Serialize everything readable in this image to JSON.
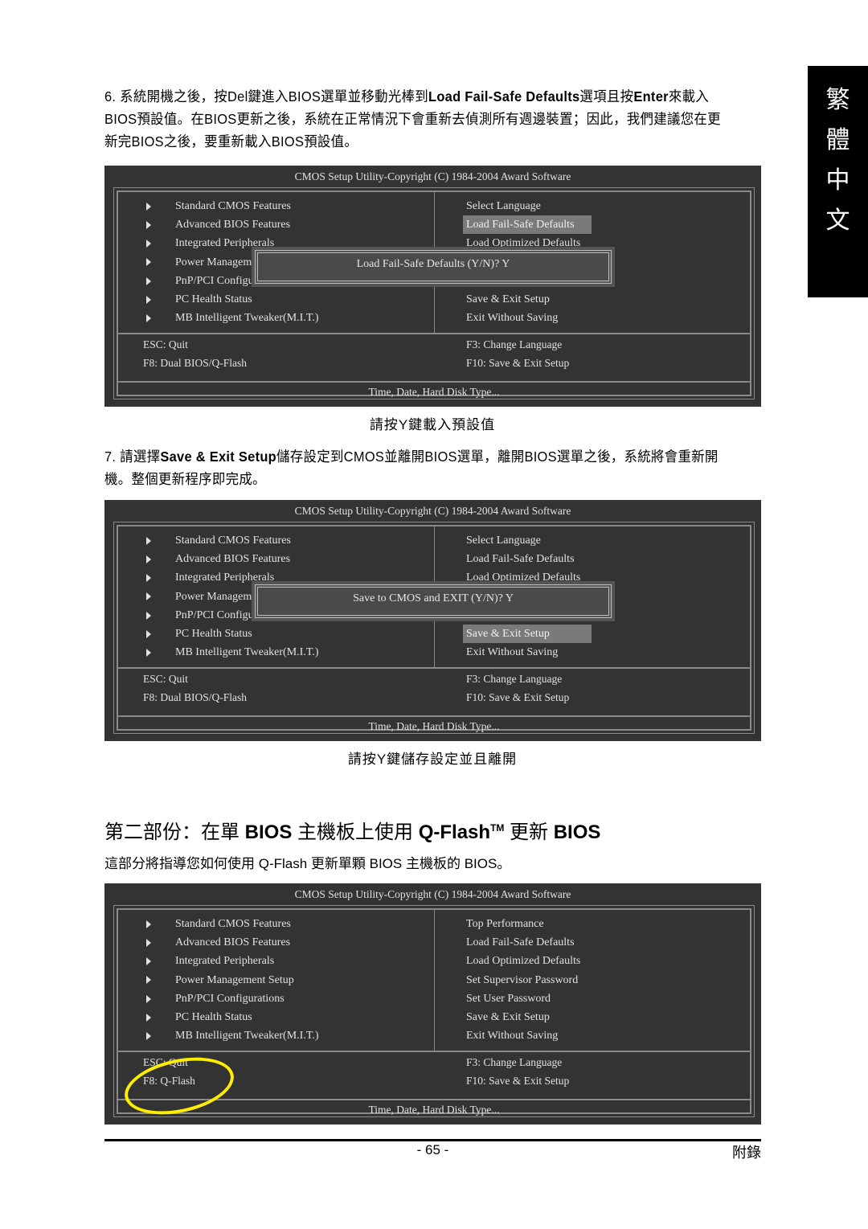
{
  "side_tab": {
    "chars": [
      "繁",
      "體",
      "中",
      "文"
    ]
  },
  "step6": {
    "num": "6.",
    "t1": " 系統開機之後，按Del鍵進入BIOS選單並移動光棒到",
    "b1": "Load Fail-Safe Defaults",
    "t2": "選項且按",
    "b2": "Enter",
    "t3": "來載入BIOS預設值。在BIOS更新之後，系統在正常情況下會重新去偵測所有週邊裝置；因此，我們建議您在更新完BIOS之後，要重新載入BIOS預設值。"
  },
  "caption1": "請按Y鍵載入預設值",
  "step7": {
    "num": "7.",
    "t1": " 請選擇",
    "b1": "Save & Exit Setup",
    "t2": "儲存設定到CMOS並離開BIOS選單，離開BIOS選單之後，系統將會重新開機。整個更新程序即完成。"
  },
  "caption2": "請按Y鍵儲存設定並且離開",
  "section": {
    "title_a": "第二部份：在單 ",
    "title_b": "BIOS",
    "title_c": " 主機板上使用 ",
    "title_d": "Q-Flash",
    "title_tm": "TM",
    "title_e": " 更新 ",
    "title_f": "BIOS",
    "subtitle": "這部分將指導您如何使用 Q-Flash 更新單顆 BIOS 主機板的 BIOS。"
  },
  "bios1": {
    "title": "CMOS Setup Utility-Copyright (C) 1984-2004 Award Software",
    "left": [
      "Standard CMOS Features",
      "Advanced BIOS Features",
      "Integrated Peripherals",
      "Power Management Setup",
      "PnP/PCI Configurations",
      "PC Health Status",
      "MB Intelligent Tweaker(M.I.T.)"
    ],
    "right": [
      "Select Language",
      "Load Fail-Safe Defaults",
      "Load Optimized Defaults",
      "",
      "",
      "Save & Exit Setup",
      "Exit Without Saving"
    ],
    "highlight_index": 1,
    "keys": {
      "esc": "ESC: Quit",
      "f8": "F8: Dual BIOS/Q-Flash",
      "f3": "F3: Change Language",
      "f10": "F10: Save & Exit Setup"
    },
    "footer": "Time, Date, Hard Disk Type...",
    "dialog": "Load Fail-Safe Defaults (Y/N)? Y"
  },
  "bios2": {
    "title": "CMOS Setup Utility-Copyright (C) 1984-2004 Award Software",
    "left": [
      "Standard CMOS Features",
      "Advanced BIOS Features",
      "Integrated Peripherals",
      "Power Management Setup",
      "PnP/PCI Configurations",
      "PC Health Status",
      "MB Intelligent Tweaker(M.I.T.)"
    ],
    "right": [
      "Select Language",
      "Load Fail-Safe Defaults",
      "Load Optimized Defaults",
      "",
      "",
      "Save & Exit Setup",
      "Exit Without Saving"
    ],
    "highlight_index": 5,
    "keys": {
      "esc": "ESC: Quit",
      "f8": "F8: Dual BIOS/Q-Flash",
      "f3": "F3: Change Language",
      "f10": "F10: Save & Exit Setup"
    },
    "footer": "Time, Date, Hard Disk Type...",
    "dialog": "Save to CMOS and EXIT (Y/N)? Y"
  },
  "bios3": {
    "title": "CMOS Setup Utility-Copyright (C) 1984-2004 Award Software",
    "left": [
      "Standard CMOS Features",
      "Advanced BIOS Features",
      "Integrated Peripherals",
      "Power Management Setup",
      "PnP/PCI Configurations",
      "PC Health Status",
      "MB Intelligent Tweaker(M.I.T.)"
    ],
    "right": [
      "Top Performance",
      "Load Fail-Safe Defaults",
      "Load Optimized Defaults",
      "Set Supervisor Password",
      "Set User Password",
      "Save & Exit Setup",
      "Exit Without Saving"
    ],
    "keys": {
      "esc": "ESC: Quit",
      "f8": "F8: Q-Flash",
      "f3": "F3: Change Language",
      "f10": "F10: Save & Exit Setup"
    },
    "footer": "Time, Date, Hard Disk Type...",
    "annotation_color": "#ffee00"
  },
  "footer": {
    "page": "- 65 -",
    "section": "附錄"
  }
}
